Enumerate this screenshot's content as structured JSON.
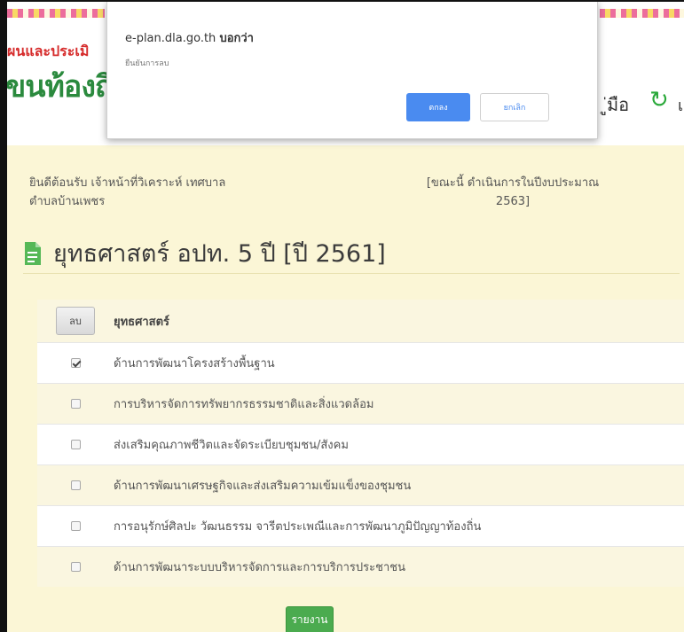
{
  "header": {
    "brand_line1": "ผนและประเมิ",
    "brand_line2": "ขนท้องถิ่",
    "nav_manual": "ู่มือ",
    "nav_cut": "เ"
  },
  "dialog": {
    "site": "e-plan.dla.go.th",
    "says": "บอกว่า",
    "message": "ยืนยันการลบ",
    "ok_label": "ตกลง",
    "cancel_label": "ยกเลิก"
  },
  "main": {
    "welcome_line1": "ยินดีต้อนรับ เจ้าหน้าที่วิเคราะห์ เทศบาล",
    "welcome_line2": "ตำบลบ้านเพชร",
    "budget_line1": "[ขณะนี้ ดำเนินการในปีงบประมาณ",
    "budget_line2": "2563]",
    "page_title": "ยุทธศาสตร์ อปท. 5 ปี [ปี 2561]",
    "report_label": "รายงาน"
  },
  "table": {
    "select_all_label": "ลบ",
    "column_header": "ยุทธศาสตร์",
    "rows": [
      {
        "label": "ด้านการพัฒนาโครงสร้างพื้นฐาน",
        "checked": true
      },
      {
        "label": "การบริหารจัดการทรัพยากรธรรมชาติและสิ่งแวดล้อม",
        "checked": false
      },
      {
        "label": "ส่งเสริมคุณภาพชีวิตและจัดระเบียบชุมชน/สังคม",
        "checked": false
      },
      {
        "label": "ด้านการพัฒนาเศรษฐกิจและส่งเสริมความเข้มแข็งของชุมชน",
        "checked": false
      },
      {
        "label": "การอนุรักษ์ศิลปะ วัฒนธรรม จารีตประเพณีและการพัฒนาภูมิปัญญาท้องถิ่น",
        "checked": false
      },
      {
        "label": "ด้านการพัฒนาระบบบริหารจัดการและการบริการประชาชน",
        "checked": false
      }
    ]
  },
  "colors": {
    "accent_green": "#4bab4f",
    "brand_red": "#d62c2c",
    "dialog_blue": "#4a8bf0",
    "panel_bg": "#fbf6d6"
  },
  "icons": {
    "title_icon": "document-icon",
    "refresh": "refresh-icon"
  }
}
